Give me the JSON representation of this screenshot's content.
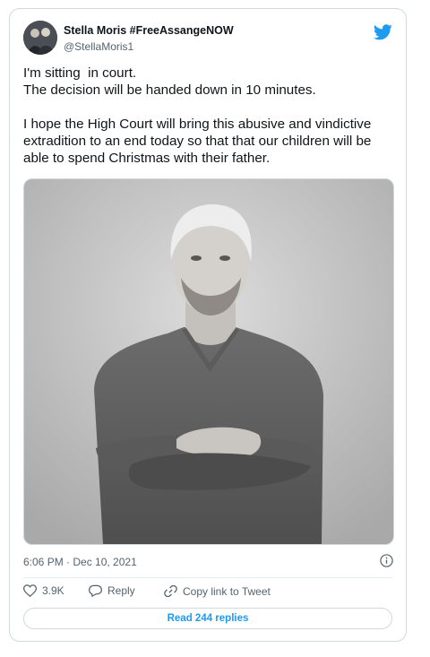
{
  "tweet": {
    "display_name": "Stella Moris #FreeAssangeNOW",
    "handle": "@StellaMoris1",
    "text_lines": [
      "I'm sitting  in court.",
      "The decision will be handed down in 10 minutes.",
      "",
      "I hope the High Court will bring this abusive and vindictive",
      "extradition to an end today so that that our children will be",
      "able to spend Christmas with their father."
    ],
    "timestamp": "6:06 PM · Dec 10, 2021"
  },
  "actions": {
    "likes": "3.9K",
    "reply_label": "Reply",
    "copy_link_label": "Copy link to Tweet"
  },
  "footer": {
    "read_replies_label": "Read 244 replies"
  },
  "icons": {
    "brand": "twitter-bird-icon",
    "info": "info-icon",
    "like": "heart-icon",
    "reply": "reply-icon",
    "copy": "link-icon"
  },
  "colors": {
    "brand_blue": "#1d9bf0",
    "text_primary": "#0f1419",
    "text_secondary": "#536471",
    "border": "#cfd9de"
  }
}
